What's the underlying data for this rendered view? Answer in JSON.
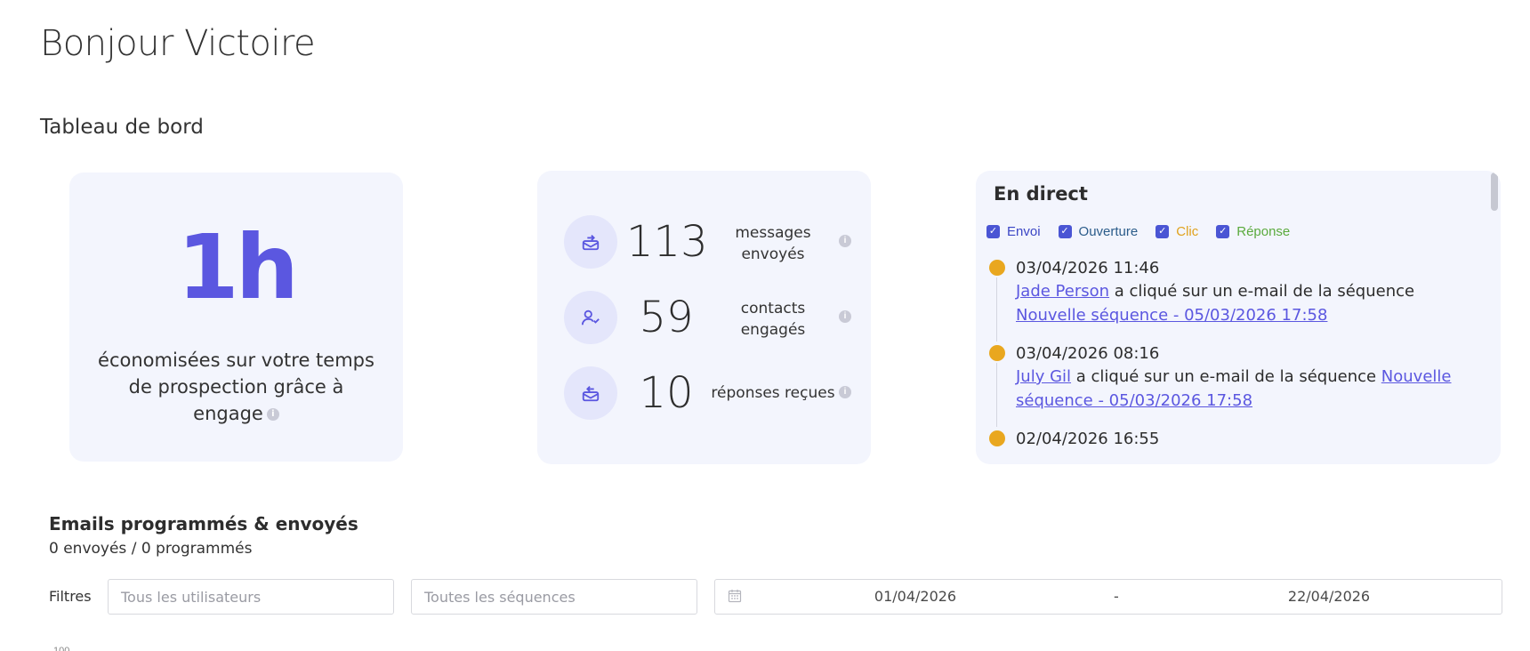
{
  "greeting": "Bonjour Victoire",
  "dashboard_title": "Tableau de bord",
  "savings": {
    "value": "1h",
    "text": "économisées sur votre temps de prospection grâce à engage"
  },
  "stats": [
    {
      "value": "113",
      "label": "messages envoyés",
      "icon": "outbox-icon"
    },
    {
      "value": "59",
      "label": "contacts engagés",
      "icon": "user-check-icon"
    },
    {
      "value": "10",
      "label": "réponses reçues",
      "icon": "inbox-icon"
    }
  ],
  "live": {
    "title": "En direct",
    "filters": [
      {
        "label": "Envoi",
        "checked": true,
        "color": "#3b46c5"
      },
      {
        "label": "Ouverture",
        "checked": true,
        "color": "#2b5c8a"
      },
      {
        "label": "Clic",
        "checked": true,
        "color": "#e0a21d"
      },
      {
        "label": "Réponse",
        "checked": true,
        "color": "#5aaa3d"
      }
    ],
    "events": [
      {
        "time": "03/04/2026 11:46",
        "contact": "Jade Person",
        "action": " a cliqué sur un e-mail de la séquence ",
        "sequence": "Nouvelle séquence - 05/03/2026 17:58"
      },
      {
        "time": "03/04/2026 08:16",
        "contact": "July Gil",
        "action": " a cliqué sur un e-mail de la séquence ",
        "sequence": "Nouvelle séquence - 05/03/2026 17:58"
      },
      {
        "time": "02/04/2026 16:55",
        "contact": "",
        "action": "",
        "sequence": ""
      }
    ]
  },
  "emails": {
    "title": "Emails programmés & envoyés",
    "subtitle": "0 envoyés / 0 programmés",
    "filters_label": "Filtres",
    "users_placeholder": "Tous les utilisateurs",
    "sequences_placeholder": "Toutes les séquences",
    "date_from": "01/04/2026",
    "date_separator": "-",
    "date_to": "22/04/2026",
    "axis_top": "100"
  },
  "colors": {
    "accent": "#5b57e0",
    "card_bg": "#f3f5fd",
    "event_dot": "#e9a71f"
  }
}
